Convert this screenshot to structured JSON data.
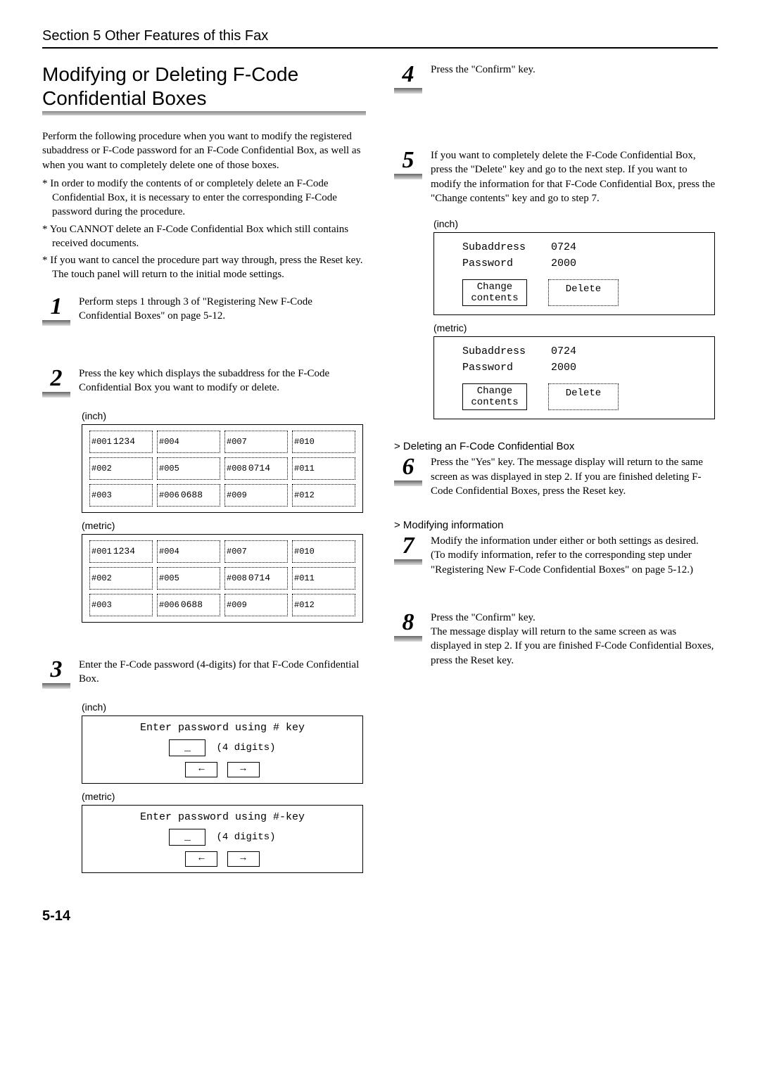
{
  "section_header": "Section 5   Other Features of this Fax",
  "title": "Modifying or Deleting F-Code Confidential Boxes",
  "intro": "Perform the following procedure when you want to modify the registered subaddress or F-Code password for an F-Code Confidential Box, as well as when you want to completely delete one of those boxes.",
  "notes": [
    "In order to modify the contents of or completely delete an F-Code Confidential Box, it is necessary to enter the corresponding F-Code password during the procedure.",
    "You CANNOT delete an F-Code Confidential Box which still contains received documents.",
    "If you want to cancel the procedure part way through, press the Reset key. The touch panel will return to the initial mode settings."
  ],
  "steps": {
    "s1": "Perform steps 1 through 3 of \"Registering New F-Code Confidential Boxes\" on page 5-12.",
    "s2": "Press the key which displays the subaddress for the F-Code Confidential Box you want to modify or delete.",
    "s3": "Enter the F-Code password (4-digits) for that F-Code Confidential Box.",
    "s4": "Press the \"Confirm\" key.",
    "s5": "If you want to completely delete the F-Code Confidential Box, press the \"Delete\" key and go to the next step. If you want to modify the information for that F-Code Confidential Box, press the \"Change contents\" key and go to step 7.",
    "s6": "Press the \"Yes\" key. The message display will return to the same screen as was displayed in step 2. If you are finished deleting F-Code Confidential Boxes, press the Reset key.",
    "s7": "Modify the information under either or both settings as desired.",
    "s7b": "(To modify information, refer to the corresponding step under \"Registering New F-Code Confidential Boxes\" on page 5-12.)",
    "s8": "Press the \"Confirm\" key.",
    "s8b": "The message display will return to the same screen as was displayed in step 2. If you are finished F-Code Confidential Boxes, press the Reset key."
  },
  "variant_inch": "(inch)",
  "variant_metric": "(metric)",
  "sub_delete": "> Deleting an F-Code Confidential Box",
  "sub_modify": "> Modifying information",
  "grid": {
    "cells": [
      {
        "idx": "#001",
        "val": "1234"
      },
      {
        "idx": "#004",
        "val": ""
      },
      {
        "idx": "#007",
        "val": ""
      },
      {
        "idx": "#010",
        "val": ""
      },
      {
        "idx": "#002",
        "val": ""
      },
      {
        "idx": "#005",
        "val": ""
      },
      {
        "idx": "#008",
        "val": "0714"
      },
      {
        "idx": "#011",
        "val": ""
      },
      {
        "idx": "#003",
        "val": ""
      },
      {
        "idx": "#006",
        "val": "0688"
      },
      {
        "idx": "#009",
        "val": ""
      },
      {
        "idx": "#012",
        "val": ""
      }
    ]
  },
  "pw": {
    "prompt_inch": "Enter password using # key",
    "prompt_metric": "Enter password using #-key",
    "value": "_",
    "digits": "(4 digits)",
    "left": "←",
    "right": "→"
  },
  "kv": {
    "sub_label": "Subaddress",
    "sub_val": "0724",
    "pw_label": "Password",
    "pw_val": "2000",
    "change_btn": "Change\ncontents",
    "delete_btn": "Delete"
  },
  "page_number": "5-14"
}
